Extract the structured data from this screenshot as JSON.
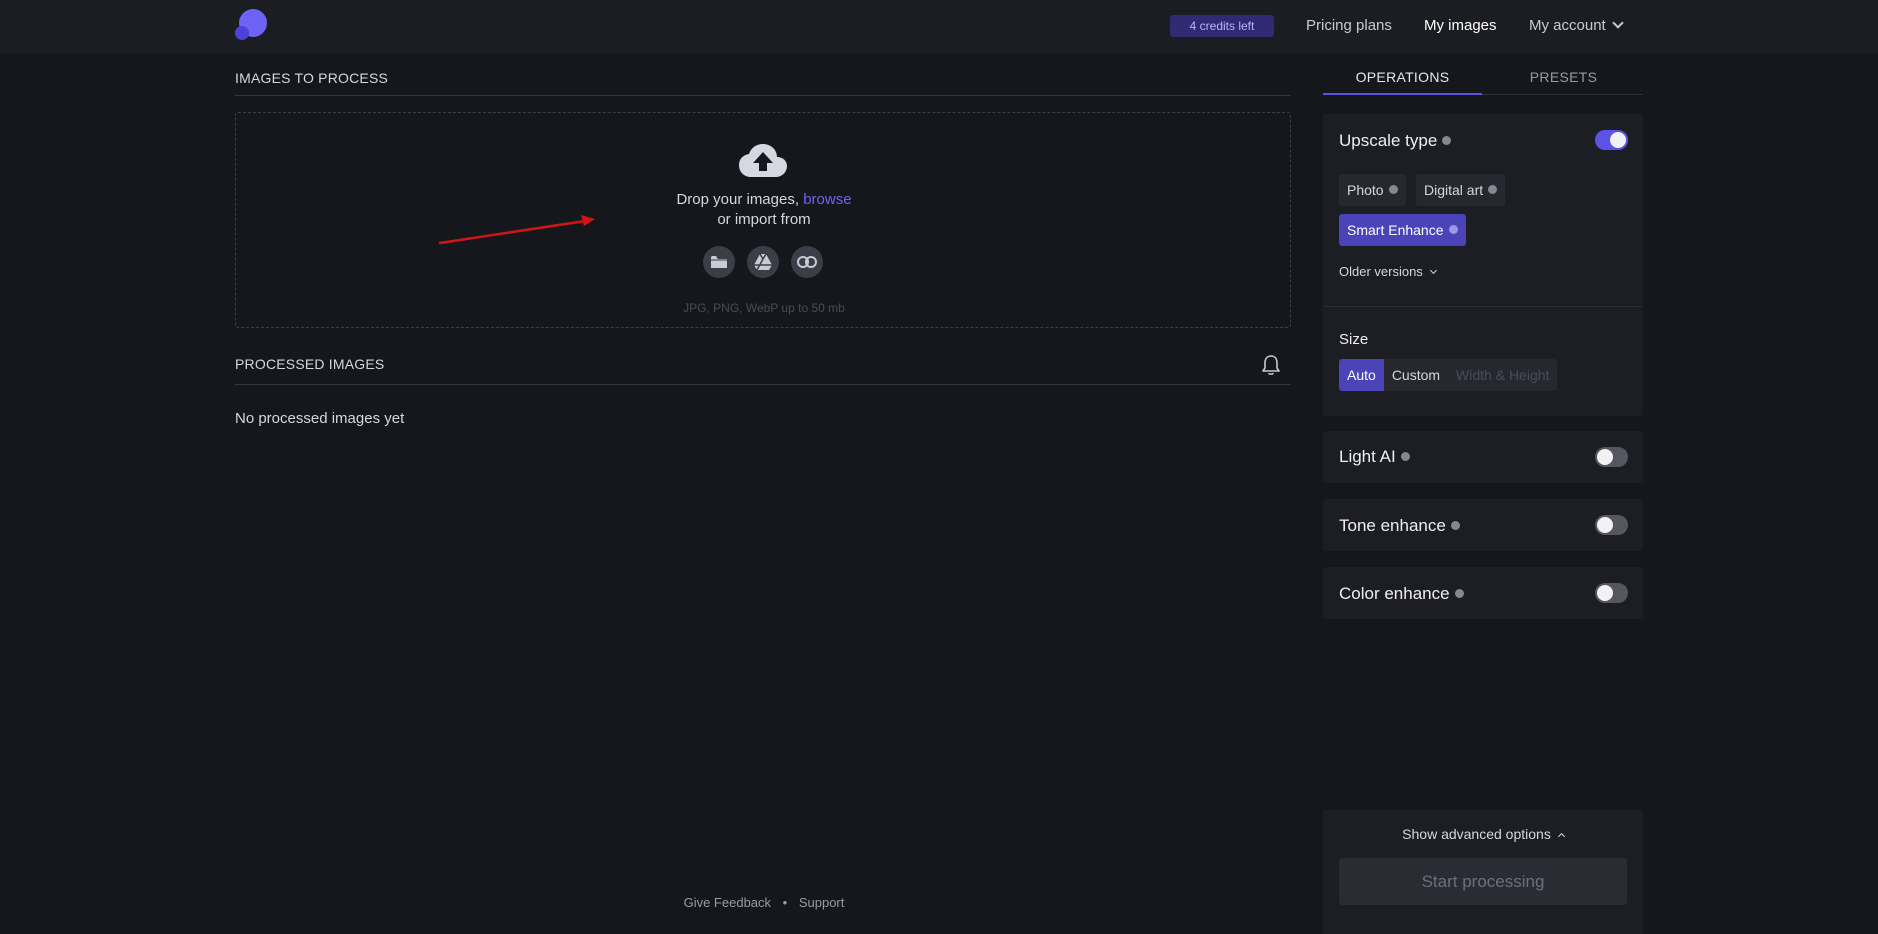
{
  "header": {
    "credits": "4 credits left",
    "nav": {
      "pricing": "Pricing plans",
      "my_images": "My images",
      "my_account": "My account"
    }
  },
  "upload": {
    "section_title": "IMAGES TO PROCESS",
    "drop_text": "Drop your images,",
    "browse": "browse",
    "import_text": "or import from",
    "formats": "JPG, PNG, WebP up to 50 mb"
  },
  "processed": {
    "section_title": "PROCESSED IMAGES",
    "empty_text": "No processed images yet"
  },
  "footer": {
    "feedback": "Give Feedback",
    "dot": "•",
    "support": "Support"
  },
  "panel": {
    "tabs": {
      "operations": "OPERATIONS",
      "presets": "PRESETS"
    },
    "upscale": {
      "title": "Upscale type",
      "enabled": true,
      "options": [
        "Photo",
        "Digital art",
        "Smart Enhance"
      ],
      "selected": "Smart Enhance",
      "older_versions": "Older versions"
    },
    "size": {
      "label": "Size",
      "auto": "Auto",
      "custom": "Custom",
      "width_height": "Width & Height",
      "selected": "Auto"
    },
    "light_ai": {
      "title": "Light AI",
      "enabled": false
    },
    "tone_enhance": {
      "title": "Tone enhance",
      "enabled": false
    },
    "color_enhance": {
      "title": "Color enhance",
      "enabled": false
    },
    "advanced": "Show advanced options",
    "start": "Start processing"
  },
  "colors": {
    "accent": "#5b52e6",
    "link": "#6d63f6",
    "background": "#16171c",
    "annotation_arrow": "#d11515"
  }
}
